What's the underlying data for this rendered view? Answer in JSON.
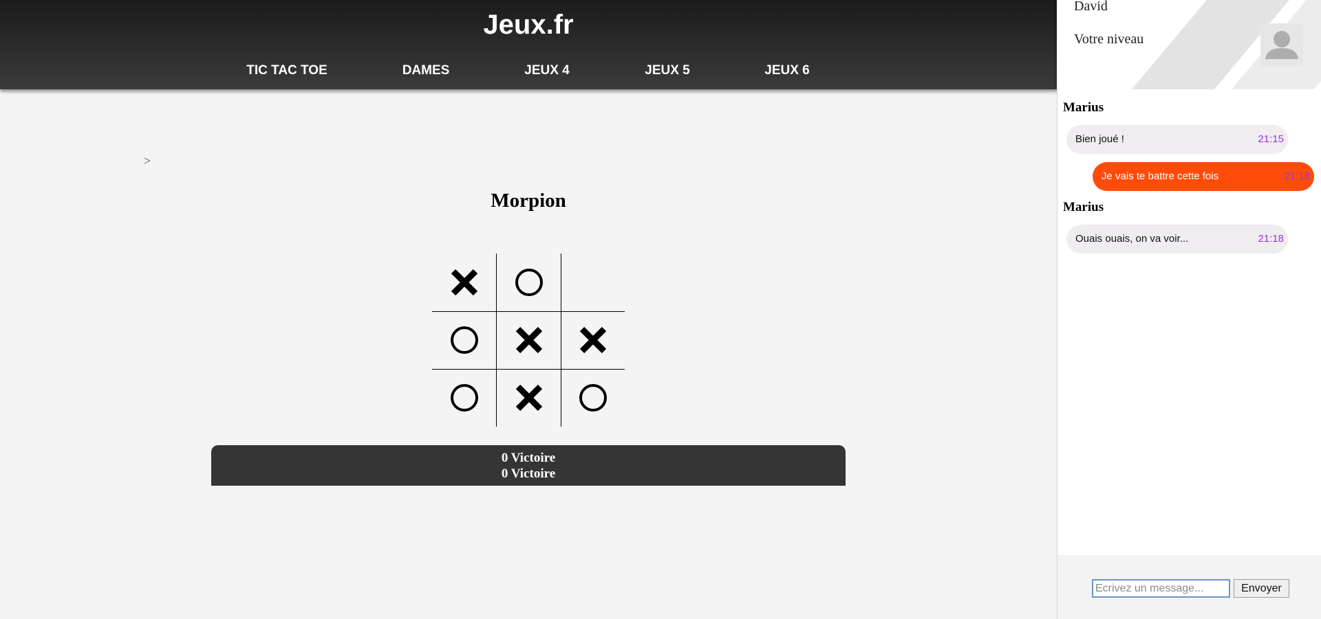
{
  "header": {
    "title": "Jeux.fr",
    "nav": [
      "TIC TAC TOE",
      "DAMES",
      "JEUX 4",
      "JEUX 5",
      "JEUX 6"
    ]
  },
  "user": {
    "name": "David",
    "level_label": "Votre niveau",
    "avatar_icon": "user-silhouette-icon"
  },
  "main": {
    "breadcrumb_arrow": ">",
    "game_title": "Morpion",
    "board": [
      [
        "X",
        "O",
        ""
      ],
      [
        "O",
        "X",
        "X"
      ],
      [
        "O",
        "X",
        "O"
      ]
    ],
    "scores": [
      "0 Victoire",
      "0 Victoire"
    ]
  },
  "chat": {
    "messages": [
      {
        "sender": "Marius",
        "text": "Bien joué !",
        "time": "21:15",
        "outgoing": false
      },
      {
        "sender": "",
        "text": "Je vais te battre cette fois",
        "time": "21:18",
        "outgoing": true
      },
      {
        "sender": "Marius",
        "text": "Ouais ouais, on va voir...",
        "time": "21:18",
        "outgoing": false
      }
    ],
    "input_placeholder": "Ecrivez un message...",
    "send_label": "Envoyer"
  },
  "colors": {
    "header_bg": "#2b2b2b",
    "outgoing_bubble": "#ff4c0a",
    "incoming_bubble": "#efedf0",
    "timestamp": "#9a37d6",
    "score_bar": "#353535"
  }
}
